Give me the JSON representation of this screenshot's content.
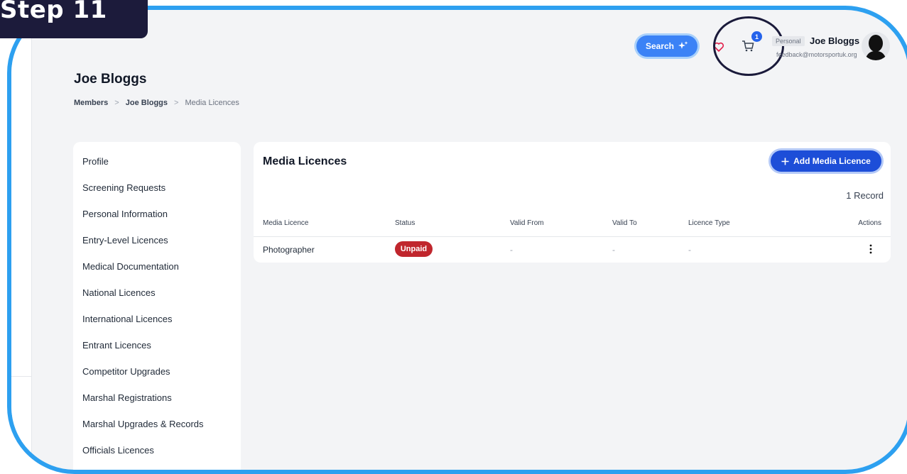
{
  "step_label": "Step 11",
  "header": {
    "search_label": "Search",
    "cart_count": "1",
    "account_tag": "Personal",
    "user_name": "Joe Bloggs",
    "user_email": "feedback@motorsportuk.org"
  },
  "page": {
    "title": "Joe Bloggs",
    "breadcrumb": [
      "Members",
      "Joe Bloggs",
      "Media Licences"
    ],
    "breadcrumb_separator": ">"
  },
  "sidebar": {
    "items": [
      "Profile",
      "Screening Requests",
      "Personal Information",
      "Entry-Level Licences",
      "Medical Documentation",
      "National Licences",
      "International Licences",
      "Entrant Licences",
      "Competitor Upgrades",
      "Marshal Registrations",
      "Marshal Upgrades & Records",
      "Officials Licences"
    ]
  },
  "card": {
    "title": "Media Licences",
    "add_button": "Add Media Licence",
    "record_count": "1 Record",
    "columns": [
      "Media Licence",
      "Status",
      "Valid From",
      "Valid To",
      "Licence Type",
      "Actions"
    ],
    "rows": [
      {
        "media_licence": "Photographer",
        "status": "Unpaid",
        "valid_from": "-",
        "valid_to": "-",
        "licence_type": "-"
      }
    ]
  },
  "colors": {
    "frame": "#2da0f0",
    "step_badge": "#1c1b3b",
    "primary": "#1d4ed8",
    "status_unpaid": "#c0262d"
  }
}
